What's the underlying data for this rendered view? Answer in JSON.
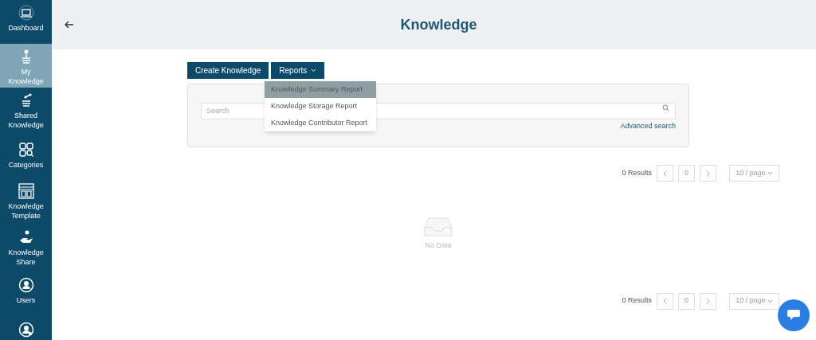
{
  "sidebar": {
    "items": [
      {
        "label": "Dashboard",
        "selected": false
      },
      {
        "label": "My Knowledge",
        "selected": true
      },
      {
        "label": "Shared Knowledge",
        "selected": false
      },
      {
        "label": "Categories",
        "selected": false
      },
      {
        "label": "Knowledge Template",
        "selected": false
      },
      {
        "label": "Knowledge Share",
        "selected": false
      },
      {
        "label": "Users",
        "selected": false
      },
      {
        "selected": false
      }
    ]
  },
  "header": {
    "title": "Knowledge"
  },
  "toolbar": {
    "buttons": [
      "Create Knowledge",
      "Reports"
    ]
  },
  "reports_menu": {
    "items": [
      {
        "label": "Knowledge Summary Report",
        "selected": true
      },
      {
        "label": "Knowledge Storage Report",
        "selected": false
      },
      {
        "label": "Knowledge Contributor Report",
        "selected": false
      }
    ]
  },
  "search": {
    "placeholder": "Search",
    "advanced_link": "Advanced search"
  },
  "pagination_top": {
    "results": "0 Results",
    "page": "0",
    "page_size": "10 / page"
  },
  "empty_state": {
    "text": "No Data"
  },
  "pagination_bottom": {
    "results": "0 Results",
    "page": "0",
    "page_size": "10 / page"
  }
}
